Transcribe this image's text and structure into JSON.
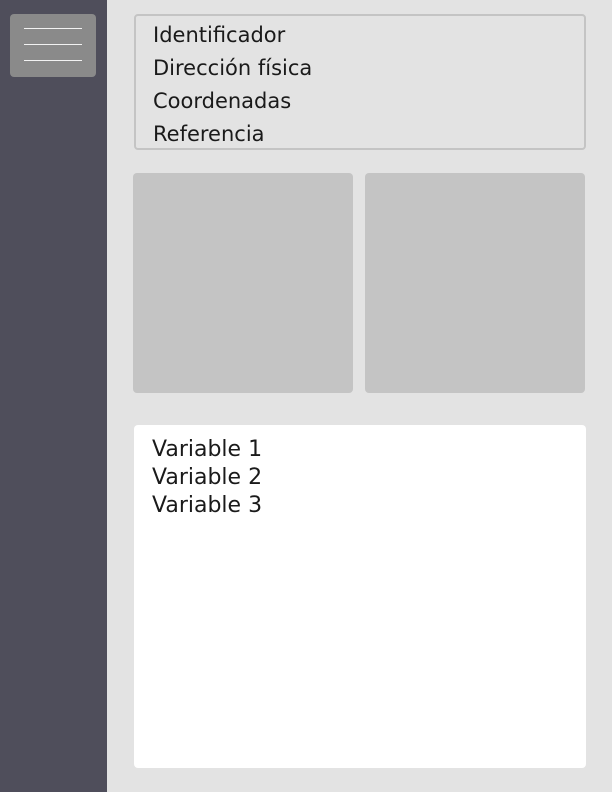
{
  "sidebar": {
    "menu_icon": "hamburger-menu-icon"
  },
  "location_info": {
    "lines": [
      "Identificador",
      "Dirección física",
      "Coordenadas",
      "Referencia"
    ]
  },
  "variables": {
    "items": [
      "Variable 1",
      "Variable 2",
      "Variable 3"
    ]
  },
  "colors": {
    "sidebar": "#4f4e5b",
    "background": "#e3e3e3",
    "placeholder_panel": "#c4c4c4",
    "menu_button": "#8a8a8a"
  }
}
